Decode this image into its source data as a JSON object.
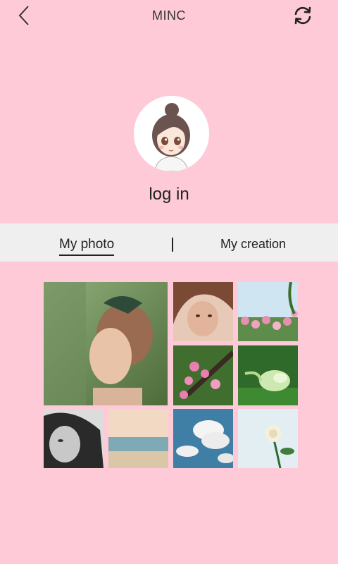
{
  "header": {
    "title": "MINC",
    "back_icon": "chevron-left-icon",
    "refresh_icon": "refresh-icon"
  },
  "profile": {
    "avatar_icon": "cartoon-girl-avatar",
    "login_label": "log in"
  },
  "tabs": {
    "photo_label": "My photo",
    "creation_label": "My creation",
    "active": "photo"
  },
  "colors": {
    "background": "#FFCAD8",
    "tabbar": "#EFEFEF",
    "text": "#222222"
  },
  "gallery": {
    "photos": [
      {
        "name": "girl-headscarf-photo"
      },
      {
        "name": "girl-lying-photo"
      },
      {
        "name": "pink-flowers-sky-photo"
      },
      {
        "name": "pink-blossom-branch-photo"
      },
      {
        "name": "green-bud-photo"
      },
      {
        "name": "bw-portrait-photo"
      },
      {
        "name": "sea-horizon-photo"
      },
      {
        "name": "clouds-sky-photo"
      },
      {
        "name": "white-rose-photo"
      }
    ]
  }
}
